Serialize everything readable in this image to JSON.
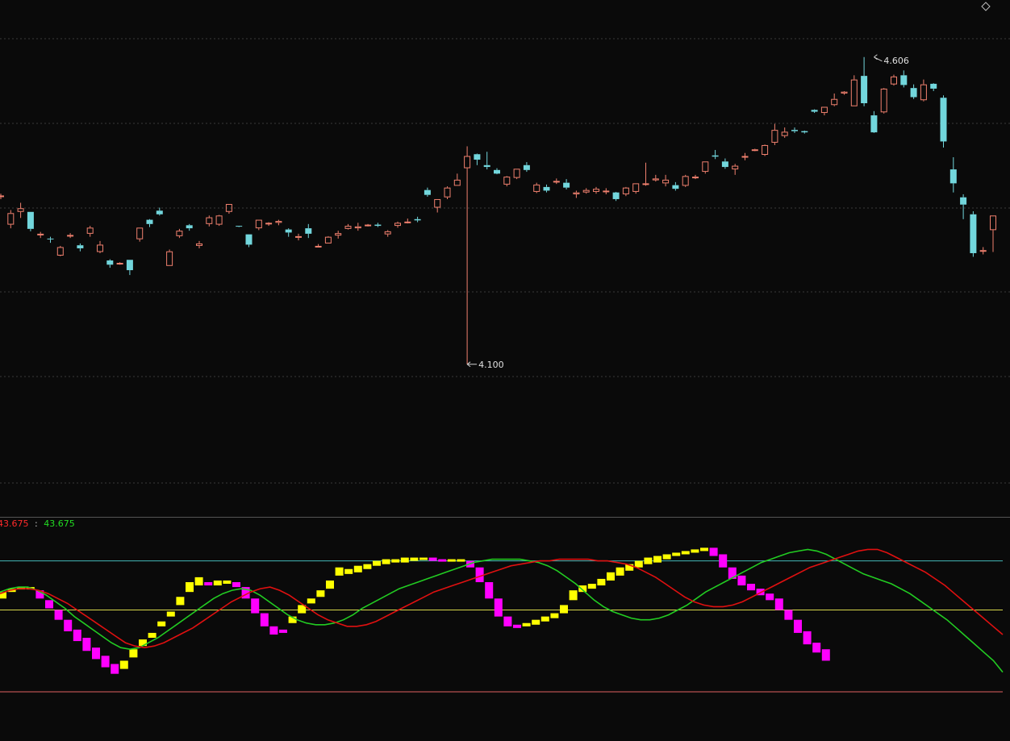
{
  "colors": {
    "background": "#0a0a0a",
    "up": "#f0806e",
    "down": "#72d6dc",
    "grid": "#3a3a3a",
    "ind_yellow": "#ffff00",
    "ind_magenta": "#ff00ff",
    "ind_red_line": "#e01010",
    "ind_green_line": "#22cc22",
    "ref_cyan": "#44b8b8",
    "ref_yellow": "#d8d84a",
    "ref_red": "#e06060"
  },
  "corner_icon": "diamond-outline-icon",
  "chart_data": [
    {
      "type": "candlestick",
      "ylim": [
        3.85,
        4.7
      ],
      "annotations": {
        "high": {
          "label": "4.606",
          "value": 4.606,
          "index": 88
        },
        "low": {
          "label": "4.100",
          "value": 4.1,
          "index": 47
        }
      },
      "candles": [
        [
          4.377,
          4.378,
          4.372,
          4.381
        ],
        [
          4.33,
          4.349,
          4.324,
          4.354
        ],
        [
          4.351,
          4.357,
          4.341,
          4.366
        ],
        [
          4.351,
          4.323,
          4.319,
          4.351
        ],
        [
          4.314,
          4.315,
          4.308,
          4.318
        ],
        [
          4.307,
          4.306,
          4.3,
          4.31
        ],
        [
          4.279,
          4.293,
          4.278,
          4.295
        ],
        [
          4.312,
          4.313,
          4.308,
          4.316
        ],
        [
          4.296,
          4.291,
          4.286,
          4.299
        ],
        [
          4.315,
          4.325,
          4.31,
          4.328
        ],
        [
          4.285,
          4.297,
          4.283,
          4.303
        ],
        [
          4.271,
          4.264,
          4.259,
          4.273
        ],
        [
          4.267,
          4.267,
          4.264,
          4.268
        ],
        [
          4.272,
          4.255,
          4.247,
          4.272
        ],
        [
          4.306,
          4.325,
          4.302,
          4.325
        ],
        [
          4.338,
          4.331,
          4.326,
          4.339
        ],
        [
          4.353,
          4.347,
          4.345,
          4.358
        ],
        [
          4.262,
          4.286,
          4.262,
          4.289
        ],
        [
          4.311,
          4.32,
          4.308,
          4.323
        ],
        [
          4.329,
          4.324,
          4.32,
          4.331
        ],
        [
          4.295,
          4.299,
          4.291,
          4.303
        ],
        [
          4.331,
          4.342,
          4.327,
          4.345
        ],
        [
          4.33,
          4.345,
          4.328,
          4.346
        ],
        [
          4.351,
          4.364,
          4.348,
          4.364
        ],
        [
          4.328,
          4.327,
          4.326,
          4.328
        ],
        [
          4.314,
          4.297,
          4.293,
          4.314
        ],
        [
          4.324,
          4.338,
          4.321,
          4.338
        ],
        [
          4.333,
          4.333,
          4.328,
          4.334
        ],
        [
          4.333,
          4.336,
          4.329,
          4.338
        ],
        [
          4.322,
          4.317,
          4.31,
          4.324
        ],
        [
          4.31,
          4.311,
          4.304,
          4.315
        ],
        [
          4.324,
          4.315,
          4.308,
          4.331
        ],
        [
          4.295,
          4.295,
          4.293,
          4.298
        ],
        [
          4.299,
          4.31,
          4.299,
          4.311
        ],
        [
          4.312,
          4.316,
          4.307,
          4.32
        ],
        [
          4.323,
          4.328,
          4.322,
          4.331
        ],
        [
          4.324,
          4.327,
          4.32,
          4.333
        ],
        [
          4.33,
          4.33,
          4.327,
          4.331
        ],
        [
          4.33,
          4.328,
          4.326,
          4.333
        ],
        [
          4.314,
          4.319,
          4.31,
          4.321
        ],
        [
          4.328,
          4.333,
          4.325,
          4.335
        ],
        [
          4.335,
          4.335,
          4.332,
          4.34
        ],
        [
          4.339,
          4.337,
          4.334,
          4.343
        ],
        [
          4.387,
          4.379,
          4.376,
          4.391
        ],
        [
          4.358,
          4.372,
          4.35,
          4.372
        ],
        [
          4.375,
          4.391,
          4.372,
          4.393
        ],
        [
          4.394,
          4.404,
          4.394,
          4.414
        ],
        [
          4.423,
          4.443,
          4.1,
          4.459
        ],
        [
          4.446,
          4.437,
          4.428,
          4.447
        ],
        [
          4.428,
          4.425,
          4.421,
          4.45
        ],
        [
          4.42,
          4.414,
          4.413,
          4.423
        ],
        [
          4.396,
          4.409,
          4.393,
          4.41
        ],
        [
          4.407,
          4.422,
          4.405,
          4.422
        ],
        [
          4.428,
          4.42,
          4.417,
          4.433
        ],
        [
          4.384,
          4.396,
          4.382,
          4.399
        ],
        [
          4.392,
          4.386,
          4.383,
          4.396
        ],
        [
          4.401,
          4.402,
          4.397,
          4.406
        ],
        [
          4.399,
          4.391,
          4.388,
          4.405
        ],
        [
          4.38,
          4.383,
          4.374,
          4.386
        ],
        [
          4.383,
          4.387,
          4.381,
          4.39
        ],
        [
          4.384,
          4.389,
          4.381,
          4.392
        ],
        [
          4.385,
          4.386,
          4.38,
          4.39
        ],
        [
          4.383,
          4.372,
          4.369,
          4.384
        ],
        [
          4.38,
          4.391,
          4.377,
          4.392
        ],
        [
          4.384,
          4.398,
          4.381,
          4.398
        ],
        [
          4.398,
          4.398,
          4.394,
          4.432
        ],
        [
          4.403,
          4.406,
          4.401,
          4.412
        ],
        [
          4.398,
          4.404,
          4.393,
          4.412
        ],
        [
          4.395,
          4.389,
          4.386,
          4.4
        ],
        [
          4.394,
          4.41,
          4.392,
          4.412
        ],
        [
          4.408,
          4.409,
          4.405,
          4.412
        ],
        [
          4.417,
          4.434,
          4.414,
          4.434
        ],
        [
          4.444,
          4.442,
          4.438,
          4.453
        ],
        [
          4.434,
          4.425,
          4.422,
          4.439
        ],
        [
          4.421,
          4.427,
          4.412,
          4.43
        ],
        [
          4.441,
          4.443,
          4.436,
          4.448
        ],
        [
          4.452,
          4.454,
          4.451,
          4.455
        ],
        [
          4.445,
          4.461,
          4.443,
          4.462
        ],
        [
          4.465,
          4.486,
          4.461,
          4.496
        ],
        [
          4.476,
          4.483,
          4.473,
          4.49
        ],
        [
          4.486,
          4.484,
          4.481,
          4.49
        ],
        [
          4.484,
          4.482,
          4.48,
          4.485
        ],
        [
          4.519,
          4.516,
          4.514,
          4.52
        ],
        [
          4.514,
          4.524,
          4.51,
          4.524
        ],
        [
          4.527,
          4.537,
          4.525,
          4.546
        ],
        [
          4.546,
          4.549,
          4.544,
          4.55
        ],
        [
          4.525,
          4.569,
          4.525,
          4.576
        ],
        [
          4.575,
          4.53,
          4.525,
          4.606
        ],
        [
          4.51,
          4.482,
          4.481,
          4.517
        ],
        [
          4.515,
          4.554,
          4.513,
          4.555
        ],
        [
          4.561,
          4.574,
          4.559,
          4.577
        ],
        [
          4.576,
          4.56,
          4.556,
          4.584
        ],
        [
          4.555,
          4.54,
          4.537,
          4.561
        ],
        [
          4.535,
          4.561,
          4.533,
          4.569
        ],
        [
          4.562,
          4.554,
          4.55,
          4.563
        ],
        [
          4.539,
          4.467,
          4.457,
          4.543
        ],
        [
          4.421,
          4.398,
          4.383,
          4.441
        ],
        [
          4.375,
          4.363,
          4.339,
          4.38
        ],
        [
          4.347,
          4.283,
          4.277,
          4.352
        ],
        [
          4.287,
          4.288,
          4.281,
          4.293
        ],
        [
          4.321,
          4.345,
          4.285,
          4.345
        ]
      ]
    },
    {
      "type": "bar+line",
      "ylim": [
        0,
        100
      ],
      "legend_sep": ":",
      "legend": [
        {
          "name": "",
          "value": "43.675",
          "color": "#ff2a2a"
        },
        {
          "name": "",
          "value": "43.675",
          "color": "#22dd22"
        }
      ],
      "reference_lines": [
        {
          "value": 80,
          "color": "#44b8b8"
        },
        {
          "value": 50,
          "color": "#d8d84a"
        },
        {
          "value": 0,
          "color": "#e06060"
        }
      ],
      "blocks": [
        [
          57,
          61
        ],
        [
          61,
          63
        ],
        [
          63,
          64
        ],
        [
          63,
          64
        ],
        [
          57,
          62
        ],
        [
          51,
          56
        ],
        [
          44,
          50
        ],
        [
          37,
          44
        ],
        [
          31,
          38
        ],
        [
          25,
          33
        ],
        [
          20,
          27
        ],
        [
          15,
          22
        ],
        [
          11,
          17
        ],
        [
          14,
          19
        ],
        [
          21,
          26
        ],
        [
          28,
          32
        ],
        [
          33,
          36
        ],
        [
          40,
          43
        ],
        [
          46,
          49
        ],
        [
          53,
          58
        ],
        [
          61,
          67
        ],
        [
          65,
          70
        ],
        [
          65,
          67
        ],
        [
          65,
          68
        ],
        [
          66,
          68
        ],
        [
          64,
          67
        ],
        [
          57,
          64
        ],
        [
          48,
          57
        ],
        [
          40,
          48
        ],
        [
          35,
          40
        ],
        [
          36,
          38
        ],
        [
          42,
          46
        ],
        [
          48,
          53
        ],
        [
          54,
          57
        ],
        [
          58,
          62
        ],
        [
          63,
          68
        ],
        [
          71,
          76
        ],
        [
          72,
          75
        ],
        [
          73,
          77
        ],
        [
          75,
          78
        ],
        [
          77,
          80
        ],
        [
          78,
          81
        ],
        [
          79,
          81
        ],
        [
          79,
          82
        ],
        [
          80,
          82
        ],
        [
          81,
          82
        ],
        [
          80,
          82
        ],
        [
          80,
          81
        ],
        [
          80,
          81
        ],
        [
          80,
          81
        ],
        [
          76,
          80
        ],
        [
          67,
          76
        ],
        [
          57,
          67
        ],
        [
          46,
          57
        ],
        [
          40,
          46
        ],
        [
          39,
          41
        ],
        [
          40,
          42
        ],
        [
          41,
          44
        ],
        [
          43,
          46
        ],
        [
          45,
          48
        ],
        [
          48,
          53
        ],
        [
          56,
          62
        ],
        [
          61,
          65
        ],
        [
          63,
          66
        ],
        [
          65,
          69
        ],
        [
          68,
          73
        ],
        [
          71,
          76
        ],
        [
          74,
          78
        ],
        [
          76,
          80
        ],
        [
          78,
          82
        ],
        [
          79,
          83
        ],
        [
          81,
          84
        ],
        [
          83,
          85
        ],
        [
          84,
          86
        ],
        [
          85,
          87
        ],
        [
          86,
          88
        ],
        [
          83,
          88
        ],
        [
          76,
          84
        ],
        [
          69,
          76
        ],
        [
          65,
          71
        ],
        [
          62,
          66
        ],
        [
          59,
          63
        ],
        [
          56,
          60
        ],
        [
          50,
          57
        ],
        [
          44,
          50
        ],
        [
          36,
          44
        ],
        [
          29,
          37
        ],
        [
          24,
          30
        ],
        [
          19,
          26
        ]
      ],
      "red_line": [
        60,
        62,
        63,
        63,
        62,
        60,
        57,
        54,
        50,
        46,
        42,
        38,
        34,
        30,
        28,
        27,
        28,
        30,
        33,
        36,
        39,
        43,
        47,
        51,
        55,
        58,
        61,
        63,
        64,
        62,
        59,
        55,
        51,
        47,
        44,
        42,
        40,
        40,
        41,
        43,
        46,
        49,
        52,
        55,
        58,
        61,
        63,
        65,
        67,
        69,
        71,
        73,
        75,
        77,
        78,
        79,
        80,
        80,
        81,
        81,
        81,
        81,
        80,
        80,
        79,
        78,
        76,
        73,
        70,
        66,
        62,
        58,
        55,
        53,
        52,
        52,
        53,
        55,
        58,
        61,
        64,
        67,
        70,
        73,
        76,
        78,
        80,
        82,
        84,
        86,
        87,
        87,
        85,
        82,
        79,
        76,
        73,
        69,
        65,
        60,
        55,
        50,
        45,
        40,
        35
      ],
      "green_line": [
        61,
        63,
        64,
        64,
        62,
        59,
        55,
        51,
        46,
        42,
        38,
        34,
        30,
        27,
        26,
        27,
        30,
        33,
        37,
        41,
        45,
        49,
        53,
        57,
        60,
        62,
        63,
        62,
        59,
        55,
        51,
        47,
        44,
        42,
        41,
        41,
        42,
        44,
        47,
        51,
        54,
        57,
        60,
        63,
        65,
        67,
        69,
        71,
        73,
        75,
        77,
        79,
        80,
        81,
        81,
        81,
        81,
        80,
        79,
        77,
        74,
        70,
        66,
        61,
        56,
        52,
        49,
        47,
        45,
        44,
        44,
        45,
        47,
        50,
        53,
        57,
        61,
        64,
        67,
        70,
        73,
        76,
        79,
        81,
        83,
        85,
        86,
        87,
        86,
        84,
        81,
        78,
        75,
        72,
        70,
        68,
        66,
        63,
        60,
        56,
        52,
        48,
        44,
        39,
        34,
        29,
        24,
        19,
        12
      ]
    }
  ]
}
